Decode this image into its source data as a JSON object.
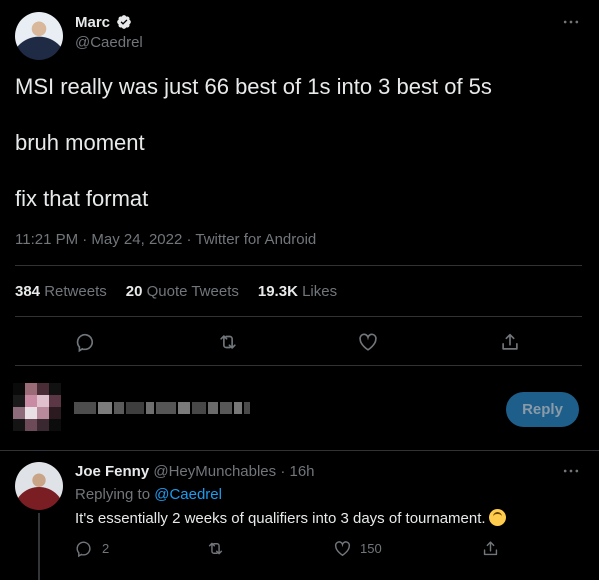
{
  "tweet": {
    "author_name": "Marc",
    "author_handle": "@Caedrel",
    "lines": [
      "MSI really was just 66 best of 1s into 3 best of 5s",
      "bruh moment",
      "fix that format"
    ],
    "meta": "11:21 PM · May 24, 2022 · Twitter for Android",
    "stats": {
      "retweets_count": "384",
      "retweets_label": "Retweets",
      "quotes_count": "20",
      "quotes_label": "Quote Tweets",
      "likes_count": "19.3K",
      "likes_label": "Likes"
    }
  },
  "composer": {
    "reply_button": "Reply"
  },
  "reply": {
    "author_name": "Joe Fenny",
    "author_handle": "@HeyMunchables",
    "time": "· 16h",
    "replying_prefix": "Replying to",
    "replying_to": "@Caedrel",
    "text": "It's essentially 2 weeks of qualifiers into 3 days of tournament.",
    "reply_count": "2",
    "like_count": "150"
  },
  "colors": {
    "accent": "#1d9bf0",
    "background": "#000000",
    "divider": "#2f3336",
    "muted": "#71767b"
  }
}
